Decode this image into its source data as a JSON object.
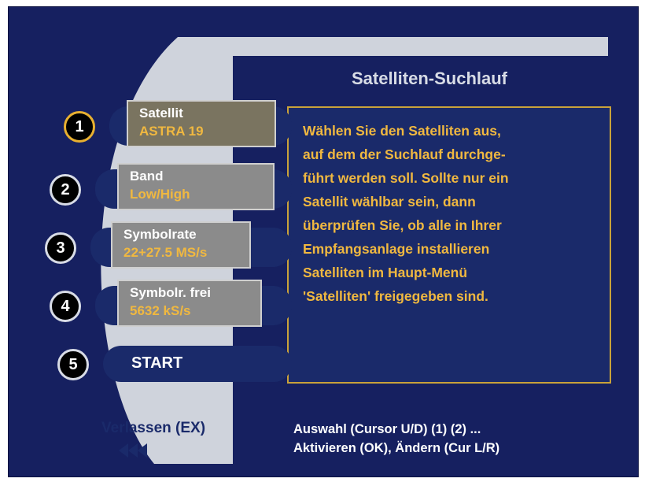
{
  "header": {
    "title": "Satelliten-Suchlauf"
  },
  "menu": {
    "items": [
      {
        "number": "1",
        "label": "Satellit",
        "value": "ASTRA 19"
      },
      {
        "number": "2",
        "label": "Band",
        "value": "Low/High"
      },
      {
        "number": "3",
        "label": "Symbolrate",
        "value": "22+27.5 MS/s"
      },
      {
        "number": "4",
        "label": "Symbolr. frei",
        "value": "5632 kS/s"
      },
      {
        "number": "5",
        "label": "START"
      }
    ]
  },
  "info": {
    "text": "Wählen Sie den Satelliten aus,\nauf dem der Suchlauf durchge-\nführt werden soll. Sollte nur ein\nSatellit wählbar sein, dann\nüberprüfen Sie, ob alle in Ihrer\nEmpfangsanlage installieren\nSatelliten im Haupt-Menü\n'Satelliten' freigegeben sind."
  },
  "footer": {
    "exit_label": "Verlassen (EX)",
    "exit_icon": "rewind-arrows-icon",
    "hint_line1": "Auswahl (Cursor U/D) (1) (2) ...",
    "hint_line2": "Aktivieren (OK), Ändern (Cur L/R)"
  },
  "colors": {
    "background": "#162060",
    "panel": "#1a2a6a",
    "frame": "#cfd3dc",
    "accent_text": "#f0b840",
    "border_highlight": "#c9a23a"
  }
}
